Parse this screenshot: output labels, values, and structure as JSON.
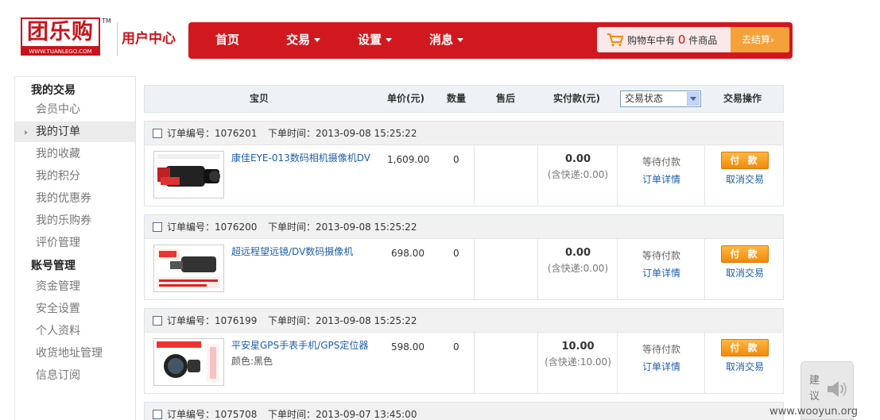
{
  "header": {
    "logo_text": "团乐购",
    "logo_tm": "TM",
    "logo_url": "WWW.TUANLEGO.COM",
    "center_title": "用户中心",
    "nav": [
      {
        "label": "首页",
        "has_caret": false
      },
      {
        "label": "交易",
        "has_caret": true
      },
      {
        "label": "设置",
        "has_caret": true
      },
      {
        "label": "消息",
        "has_caret": true
      }
    ],
    "cart_prefix": "购物车中有",
    "cart_count": "0",
    "cart_suffix": "件商品",
    "checkout_label": "去结算",
    "checkout_arrow": "›"
  },
  "sidebar": {
    "section1": "我的交易",
    "items1": [
      "会员中心",
      "我的订单",
      "我的收藏",
      "我的积分",
      "我的优惠券",
      "我的乐购券",
      "评价管理"
    ],
    "section2": "账号管理",
    "items2": [
      "资金管理",
      "安全设置",
      "个人资料",
      "收货地址管理",
      "信息订阅"
    ],
    "active": "我的订单"
  },
  "table": {
    "headers": {
      "product": "宝贝",
      "price": "单价(元)",
      "qty": "数量",
      "aftersale": "售后",
      "paid": "实付款(元)",
      "status_select": "交易状态",
      "actions": "交易操作"
    }
  },
  "orders": [
    {
      "order_no": "订单编号：1076201",
      "order_time": "下单时间：2013-09-08 15:25:22",
      "product_name": "康佳EYE-013数码相机摄像机DV",
      "product_attr": "",
      "price": "1,609.00",
      "qty": "0",
      "total": "0.00",
      "shipping": "(含快递:0.00)",
      "status": "等待付款",
      "detail": "订单详情",
      "pay": "付 款",
      "cancel": "取消交易"
    },
    {
      "order_no": "订单编号：1076200",
      "order_time": "下单时间：2013-09-08 15:25:22",
      "product_name": "超远程望远镜/DV数码摄像机",
      "product_attr": "",
      "price": "698.00",
      "qty": "0",
      "total": "0.00",
      "shipping": "(含快递:0.00)",
      "status": "等待付款",
      "detail": "订单详情",
      "pay": "付 款",
      "cancel": "取消交易"
    },
    {
      "order_no": "订单编号：1076199",
      "order_time": "下单时间：2013-09-08 15:25:22",
      "product_name": "平安星GPS手表手机/GPS定位器",
      "product_attr": "颜色:黑色",
      "price": "598.00",
      "qty": "0",
      "total": "10.00",
      "shipping": "(含快递:10.00)",
      "status": "等待付款",
      "detail": "订单详情",
      "pay": "付 款",
      "cancel": "取消交易"
    },
    {
      "order_no": "订单编号：1075708",
      "order_time": "下单时间：2013-09-07 13:45:00"
    }
  ],
  "suggest": {
    "label": "建议"
  },
  "watermark": "www.wooyun.org",
  "colors": {
    "brand_red": "#d1181f",
    "pay_orange": "#f49a1a",
    "link_blue": "#1f5ea8"
  }
}
